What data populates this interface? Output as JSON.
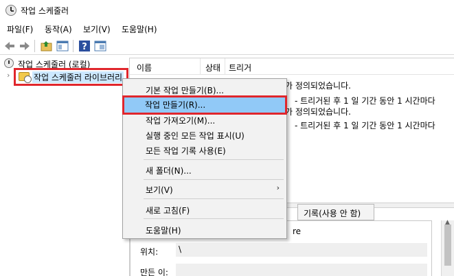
{
  "window": {
    "title": "작업 스케줄러"
  },
  "menubar": {
    "items": [
      "파일(F)",
      "동작(A)",
      "보기(V)",
      "도움말(H)"
    ]
  },
  "toolbar": {
    "icons": [
      "back-arrow-icon",
      "forward-arrow-icon",
      "folder-up-icon",
      "show-hide-pane-icon",
      "help-icon",
      "properties-icon"
    ]
  },
  "tree": {
    "root_label": "작업 스케줄러 (로컬)",
    "child_label": "작업 스케줄러 라이브러리"
  },
  "list": {
    "columns": [
      "이름",
      "상태",
      "트리거"
    ],
    "rows": [
      "가 정의되었습니다.",
      "- 트리거된 후 1 일 기간 동안 1 시간마다",
      "가 정의되었습니다.",
      "- 트리거된 후 1 일 기간 동안 1 시간마다"
    ]
  },
  "tabs": {
    "history": "기록(사용 안 함)"
  },
  "detail": {
    "location_label": "위치:",
    "location_value": "\\",
    "author_label": "만든 이:",
    "partial_text": "re"
  },
  "context_menu": {
    "items": [
      "기본 작업 만들기(B)...",
      "작업 만들기(R)...",
      "작업 가져오기(M)...",
      "실행 중인 모든 작업 표시(U)",
      "모든 작업 기록 사용(E)",
      "새 폴더(N)...",
      "보기(V)",
      "새로 고침(F)",
      "도움말(H)"
    ],
    "submenu_arrow": "›"
  },
  "colors": {
    "highlight_border": "#e0262c",
    "highlight_fill": "#91c9f7"
  }
}
